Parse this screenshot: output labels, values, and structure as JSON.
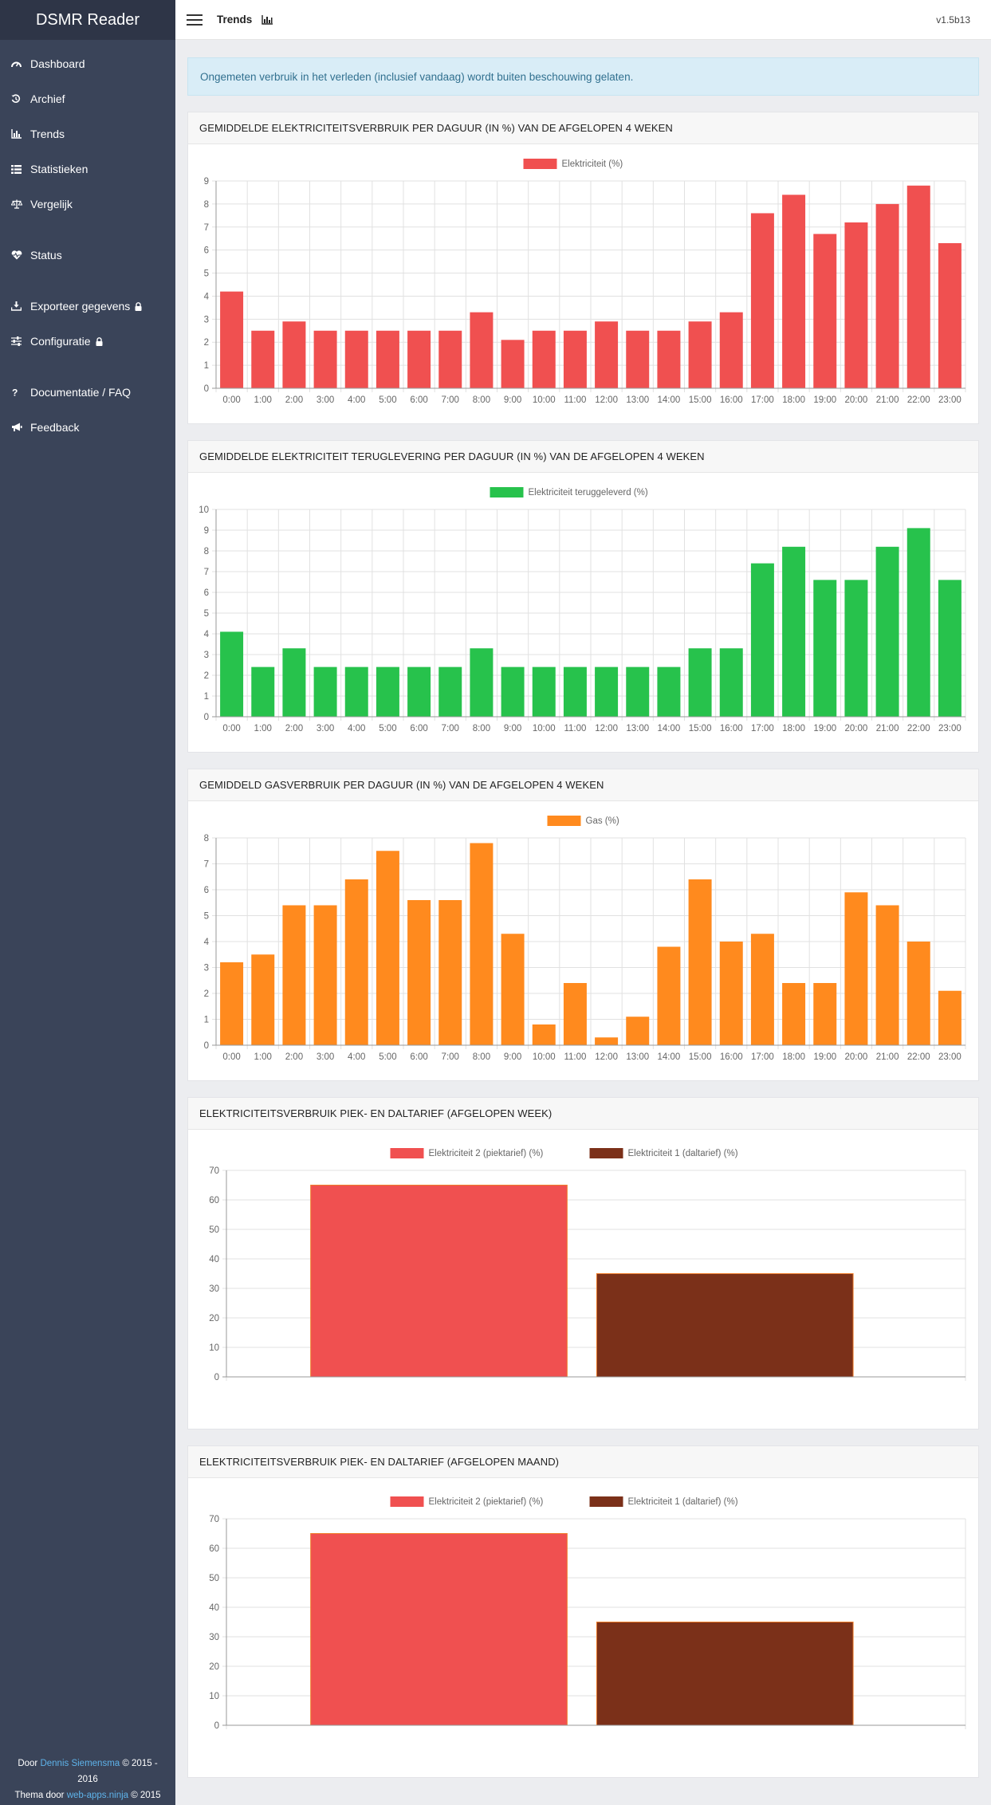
{
  "sidebar": {
    "brand": "DSMR Reader",
    "items": [
      {
        "label": "Dashboard",
        "icon": "dashboard-icon"
      },
      {
        "label": "Archief",
        "icon": "history-icon"
      },
      {
        "label": "Trends",
        "icon": "bar-chart-icon"
      },
      {
        "label": "Statistieken",
        "icon": "list-icon"
      },
      {
        "label": "Vergelijk",
        "icon": "balance-scale-icon"
      },
      {
        "label": "Status",
        "icon": "heartbeat-icon"
      },
      {
        "label": "Exporteer gegevens",
        "icon": "download-icon"
      },
      {
        "label": "Configuratie",
        "icon": "sliders-icon"
      },
      {
        "label": "Documentatie / FAQ",
        "icon": "question-icon"
      },
      {
        "label": "Feedback",
        "icon": "bullhorn-icon"
      }
    ],
    "footer": {
      "line1_prefix": "Door ",
      "line1_link": "Dennis Siemensma",
      "line1_suffix": " © 2015 -",
      "line1b": "2016",
      "line2_prefix": "Thema door ",
      "line2_link": "web-apps.ninja",
      "line2_suffix": " © 2015"
    }
  },
  "topbar": {
    "title": "Trends",
    "version": "v1.5b13"
  },
  "alert": "Ongemeten verbruik in het verleden (inclusief vandaag) wordt buiten beschouwing gelaten.",
  "panels": [
    {
      "title": "GEMIDDELDE ELEKTRICITEITSVERBRUIK PER DAGUUR (IN %) VAN DE AFGELOPEN 4 WEKEN"
    },
    {
      "title": "GEMIDDELDE ELEKTRICITEIT TERUGLEVERING PER DAGUUR (IN %) VAN DE AFGELOPEN 4 WEKEN"
    },
    {
      "title": "GEMIDDELD GASVERBRUIK PER DAGUUR (IN %) VAN DE AFGELOPEN 4 WEKEN"
    },
    {
      "title": "ELEKTRICITEITSVERBRUIK PIEK- EN DALTARIEF (AFGELOPEN WEEK)"
    },
    {
      "title": "ELEKTRICITEITSVERBRUIK PIEK- EN DALTARIEF (AFGELOPEN MAAND)"
    }
  ],
  "colors": {
    "electricity": "#f05050",
    "returned": "#27c24c",
    "gas": "#ff8a1e",
    "low_tariff": "#7b3019",
    "sidebar": "#3a4459",
    "link": "#5eb3ea"
  },
  "chart_data": [
    {
      "type": "bar",
      "categories": [
        "0:00",
        "1:00",
        "2:00",
        "3:00",
        "4:00",
        "5:00",
        "6:00",
        "7:00",
        "8:00",
        "9:00",
        "10:00",
        "11:00",
        "12:00",
        "13:00",
        "14:00",
        "15:00",
        "16:00",
        "17:00",
        "18:00",
        "19:00",
        "20:00",
        "21:00",
        "22:00",
        "23:00"
      ],
      "series": [
        {
          "name": "Elektriciteit (%)",
          "values": [
            4.2,
            2.5,
            2.9,
            2.5,
            2.5,
            2.5,
            2.5,
            2.5,
            3.3,
            2.1,
            2.5,
            2.5,
            2.9,
            2.5,
            2.5,
            2.9,
            3.3,
            7.6,
            8.4,
            6.7,
            7.2,
            8.0,
            8.8,
            6.3
          ]
        }
      ],
      "ylim": [
        0,
        9
      ],
      "yticks": [
        0,
        1,
        2,
        3,
        4,
        5,
        6,
        7,
        8,
        9
      ],
      "legend": "top-center"
    },
    {
      "type": "bar",
      "categories": [
        "0:00",
        "1:00",
        "2:00",
        "3:00",
        "4:00",
        "5:00",
        "6:00",
        "7:00",
        "8:00",
        "9:00",
        "10:00",
        "11:00",
        "12:00",
        "13:00",
        "14:00",
        "15:00",
        "16:00",
        "17:00",
        "18:00",
        "19:00",
        "20:00",
        "21:00",
        "22:00",
        "23:00"
      ],
      "series": [
        {
          "name": "Elektriciteit teruggeleverd (%)",
          "values": [
            4.1,
            2.4,
            3.3,
            2.4,
            2.4,
            2.4,
            2.4,
            2.4,
            3.3,
            2.4,
            2.4,
            2.4,
            2.4,
            2.4,
            2.4,
            3.3,
            3.3,
            7.4,
            8.2,
            6.6,
            6.6,
            8.2,
            9.1,
            6.6
          ]
        }
      ],
      "ylim": [
        0,
        10
      ],
      "yticks": [
        0,
        1,
        2,
        3,
        4,
        5,
        6,
        7,
        8,
        9,
        10
      ],
      "legend": "top-center"
    },
    {
      "type": "bar",
      "categories": [
        "0:00",
        "1:00",
        "2:00",
        "3:00",
        "4:00",
        "5:00",
        "6:00",
        "7:00",
        "8:00",
        "9:00",
        "10:00",
        "11:00",
        "12:00",
        "13:00",
        "14:00",
        "15:00",
        "16:00",
        "17:00",
        "18:00",
        "19:00",
        "20:00",
        "21:00",
        "22:00",
        "23:00"
      ],
      "series": [
        {
          "name": "Gas (%)",
          "values": [
            3.2,
            3.5,
            5.4,
            5.4,
            6.4,
            7.5,
            5.6,
            5.6,
            7.8,
            4.3,
            0.8,
            2.4,
            0.3,
            1.1,
            3.8,
            6.4,
            4.0,
            4.3,
            2.4,
            2.4,
            5.9,
            5.4,
            4.0,
            2.1
          ]
        }
      ],
      "ylim": [
        0,
        8
      ],
      "yticks": [
        0,
        1,
        2,
        3,
        4,
        5,
        6,
        7,
        8
      ],
      "legend": "top-center"
    },
    {
      "type": "bar",
      "categories": [
        ""
      ],
      "series": [
        {
          "name": "Elektriciteit 2 (piektarief) (%)",
          "values": [
            65
          ]
        },
        {
          "name": "Elektriciteit 1 (daltarief) (%)",
          "values": [
            35
          ]
        }
      ],
      "ylim": [
        0,
        70
      ],
      "yticks": [
        0,
        10,
        20,
        30,
        40,
        50,
        60,
        70
      ],
      "legend": "top-center"
    },
    {
      "type": "bar",
      "categories": [
        ""
      ],
      "series": [
        {
          "name": "Elektriciteit 2 (piektarief) (%)",
          "values": [
            65
          ]
        },
        {
          "name": "Elektriciteit 1 (daltarief) (%)",
          "values": [
            35
          ]
        }
      ],
      "ylim": [
        0,
        70
      ],
      "yticks": [
        0,
        10,
        20,
        30,
        40,
        50,
        60,
        70
      ],
      "legend": "top-center"
    }
  ]
}
